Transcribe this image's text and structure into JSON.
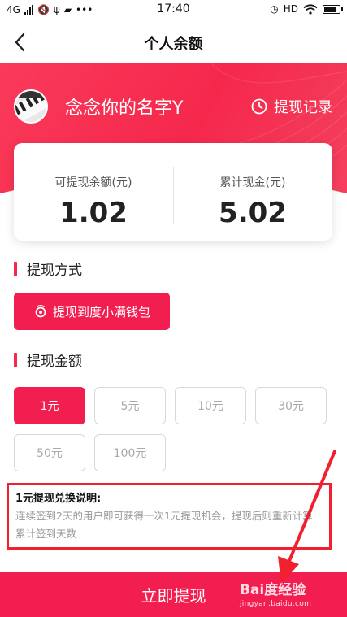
{
  "status_bar": {
    "network": "4G",
    "time": "17:40",
    "hd": "HD",
    "more": "•••"
  },
  "nav": {
    "title": "个人余额"
  },
  "profile": {
    "username": "念念你的名字Y",
    "history_label": "提现记录"
  },
  "balance": {
    "withdrawable_label": "可提现余额(元)",
    "withdrawable_value": "1.02",
    "total_label": "累计现金(元)",
    "total_value": "5.02"
  },
  "method_section": {
    "title": "提现方式",
    "button_label": "提现到度小满钱包"
  },
  "amount_section": {
    "title": "提现金额",
    "options": [
      "1元",
      "5元",
      "10元",
      "30元",
      "50元",
      "100元"
    ],
    "selected": "1元"
  },
  "note": {
    "title": "1元提现兑换说明:",
    "body": "连续签到2天的用户即可获得一次1元提现机会，提现后则重新计算累计签到天数"
  },
  "submit": {
    "label": "立即提现"
  },
  "watermark": {
    "logo": "Bai度经验",
    "url": "jingyan.baidu.com"
  },
  "colors": {
    "accent": "#f21e50",
    "annotation": "#f02030"
  }
}
